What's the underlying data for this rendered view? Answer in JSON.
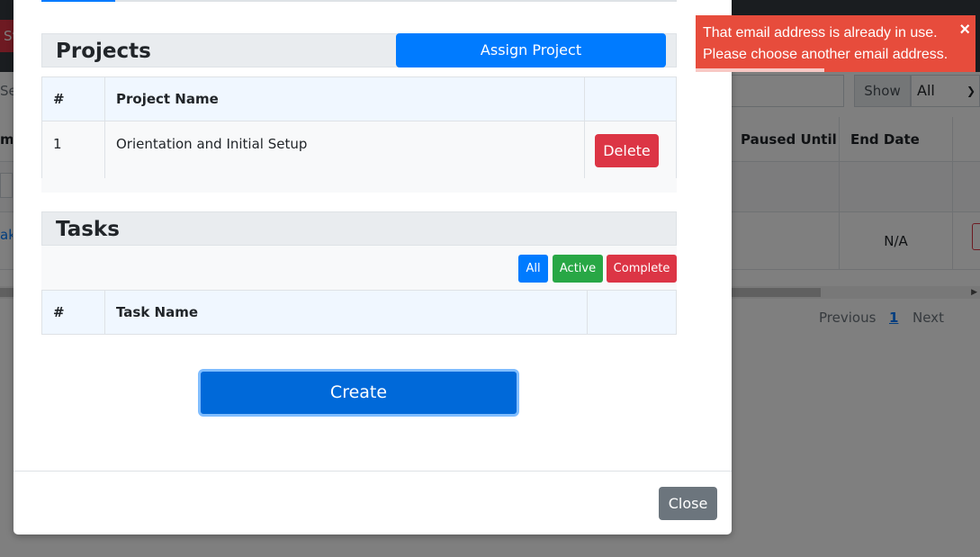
{
  "background": {
    "red_button_text": "St",
    "search_placeholder": "Search",
    "show_label": "Show",
    "page_size_selected": "All",
    "table_headers": {
      "first_col_fragment": "m",
      "paused_until": "Paused Until",
      "end_date": "End Date"
    },
    "row": {
      "link_fragment": "aki",
      "end_date_value": "N/A"
    },
    "pager": {
      "previous": "Previous",
      "current": "1",
      "next": "Next"
    }
  },
  "modal": {
    "projects": {
      "title": "Projects",
      "assign_button": "Assign Project",
      "headers": [
        "#",
        "Project Name",
        ""
      ],
      "rows": [
        {
          "num": "1",
          "name": "Orientation and Initial Setup",
          "action": "Delete"
        }
      ]
    },
    "tasks": {
      "title": "Tasks",
      "filters": {
        "all": "All",
        "active": "Active",
        "complete": "Complete"
      },
      "headers": [
        "#",
        "Task Name",
        ""
      ],
      "rows": []
    },
    "create_button": "Create",
    "close_button": "Close"
  },
  "toast": {
    "message_line1": "That email address is already in use.",
    "message_line2": "Please choose another email address.",
    "close_glyph": "×",
    "progress_fraction": 0.46
  },
  "colors": {
    "primary": "#007bff",
    "danger": "#dc3545",
    "success": "#28a745",
    "secondary": "#6c757d",
    "toast": "#e74c3c"
  }
}
